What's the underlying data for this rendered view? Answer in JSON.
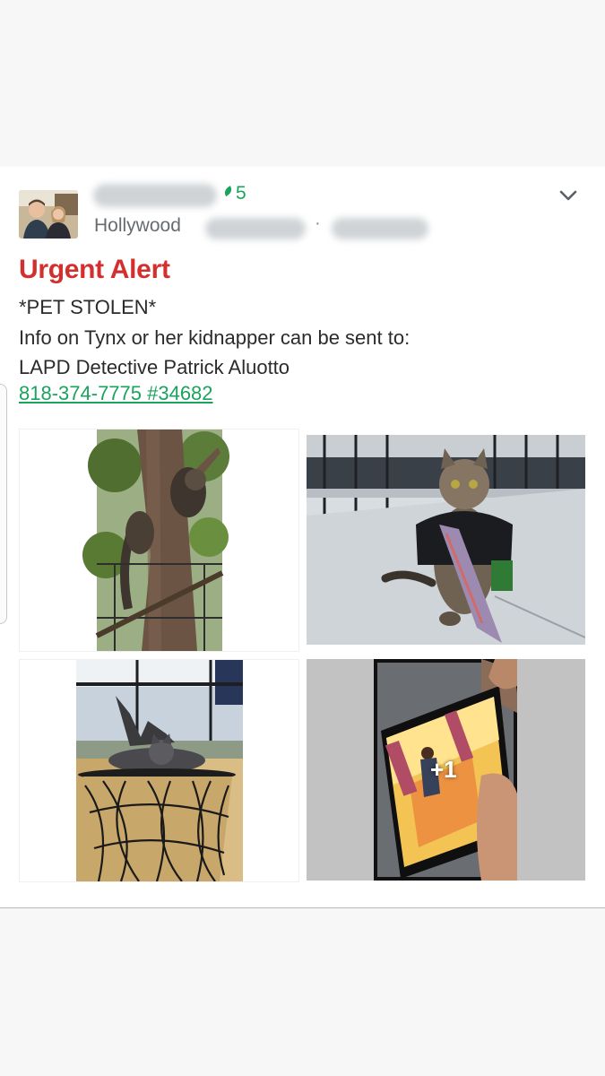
{
  "post": {
    "author_karma": "5",
    "location_prefix": "Hollywood",
    "title": "Urgent Alert",
    "lines": [
      "*PET STOLEN*",
      "Info on Tynx or her kidnapper can be sent to:",
      "LAPD Detective Patrick Aluotto"
    ],
    "phone_link": "818-374-7775 #34682",
    "more_photos": "+1"
  },
  "icons": {
    "menu": "chevron-down-icon",
    "karma": "leaf-icon"
  },
  "colors": {
    "title_red": "#d42f2f",
    "link_green": "#1aa35c",
    "text_dark": "#2b2b2b",
    "meta_gray": "#666b70"
  }
}
